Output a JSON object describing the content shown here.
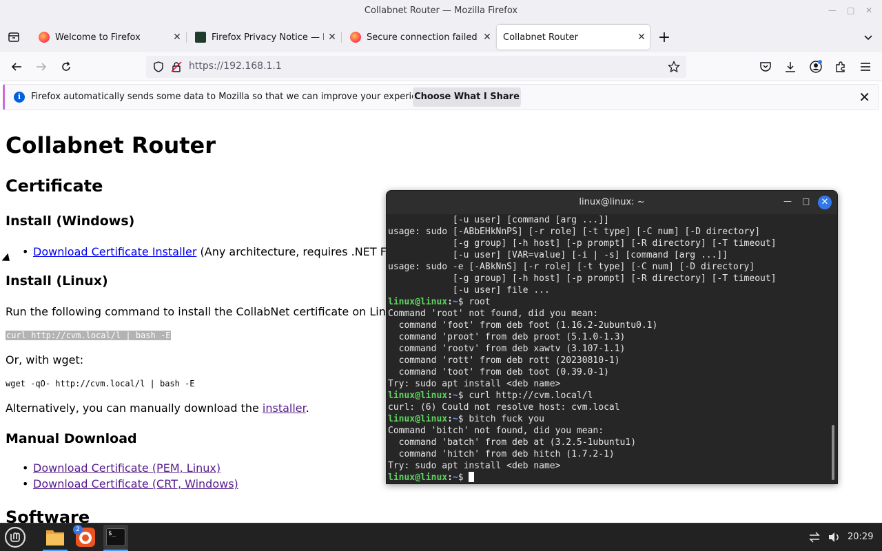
{
  "window": {
    "title": "Collabnet Router — Mozilla Firefox"
  },
  "tabs": [
    {
      "label": "Welcome to Firefox"
    },
    {
      "label": "Firefox Privacy Notice — Mo"
    },
    {
      "label": "Secure connection failed an"
    },
    {
      "label": "Collabnet Router"
    }
  ],
  "navbar": {
    "url": "https://192.168.1.1"
  },
  "notification": {
    "message": "Firefox automatically sends some data to Mozilla so that we can improve your experience.",
    "button": "Choose What I Share"
  },
  "page": {
    "title": "Collabnet Router",
    "certificate_heading": "Certificate",
    "install_windows_heading": "Install (Windows)",
    "windows_link": "Download Certificate Installer",
    "windows_note": "(Any architecture, requires .NET Frame",
    "install_linux_heading": "Install (Linux)",
    "linux_intro": "Run the following command to install the CollabNet certificate on Linux:",
    "curl_cmd": "curl http://cvm.local/l | bash -E",
    "wget_intro": "Or, with wget:",
    "wget_cmd": "wget -qO- http://cvm.local/l | bash -E",
    "manual_prefix": "Alternatively, you can manually download the ",
    "manual_link": "installer",
    "manual_suffix": ".",
    "manual_heading": "Manual Download",
    "pem_link": "Download Certificate (PEM, Linux)",
    "crt_link": "Download Certificate (CRT, Windows)",
    "software_heading": "Software"
  },
  "terminal": {
    "title": "linux@linux: ~",
    "prompt_user": "linux@linux",
    "prompt_path": "~",
    "lines": [
      {
        "type": "out",
        "text": "            [-u user] [command [arg ...]]"
      },
      {
        "type": "out",
        "text": "usage: sudo [-ABbEHkNnPS] [-r role] [-t type] [-C num] [-D directory]"
      },
      {
        "type": "out",
        "text": "            [-g group] [-h host] [-p prompt] [-R directory] [-T timeout]"
      },
      {
        "type": "out",
        "text": "            [-u user] [VAR=value] [-i | -s] [command [arg ...]]"
      },
      {
        "type": "out",
        "text": "usage: sudo -e [-ABkNnS] [-r role] [-t type] [-C num] [-D directory]"
      },
      {
        "type": "out",
        "text": "            [-g group] [-h host] [-p prompt] [-R directory] [-T timeout]"
      },
      {
        "type": "out",
        "text": "            [-u user] file ..."
      },
      {
        "type": "cmd",
        "text": "root"
      },
      {
        "type": "out",
        "text": "Command 'root' not found, did you mean:"
      },
      {
        "type": "out",
        "text": "  command 'foot' from deb foot (1.16.2-2ubuntu0.1)"
      },
      {
        "type": "out",
        "text": "  command 'proot' from deb proot (5.1.0-1.3)"
      },
      {
        "type": "out",
        "text": "  command 'rootv' from deb xawtv (3.107-1.1)"
      },
      {
        "type": "out",
        "text": "  command 'rott' from deb rott (20230810-1)"
      },
      {
        "type": "out",
        "text": "  command 'toot' from deb toot (0.39.0-1)"
      },
      {
        "type": "out",
        "text": "Try: sudo apt install <deb name>"
      },
      {
        "type": "cmd",
        "text": "curl http://cvm.local/l"
      },
      {
        "type": "out",
        "text": "curl: (6) Could not resolve host: cvm.local"
      },
      {
        "type": "cmd",
        "text": "bitch fuck you"
      },
      {
        "type": "out",
        "text": "Command 'bitch' not found, did you mean:"
      },
      {
        "type": "out",
        "text": "  command 'batch' from deb at (3.2.5-1ubuntu1)"
      },
      {
        "type": "out",
        "text": "  command 'hitch' from deb hitch (1.7.2-1)"
      },
      {
        "type": "out",
        "text": "Try: sudo apt install <deb name>"
      },
      {
        "type": "cursor",
        "text": ""
      }
    ]
  },
  "taskbar": {
    "firefox_badge": "2",
    "terminal_icon_text": "$_",
    "clock": "20:29"
  },
  "colors": {
    "link": "#0000ee",
    "visited_link": "#551a8b",
    "prompt_green": "#5fd35f",
    "prompt_blue": "#6b9bff",
    "terminal_bg": "#262626",
    "accent_blue": "#3478e8"
  }
}
